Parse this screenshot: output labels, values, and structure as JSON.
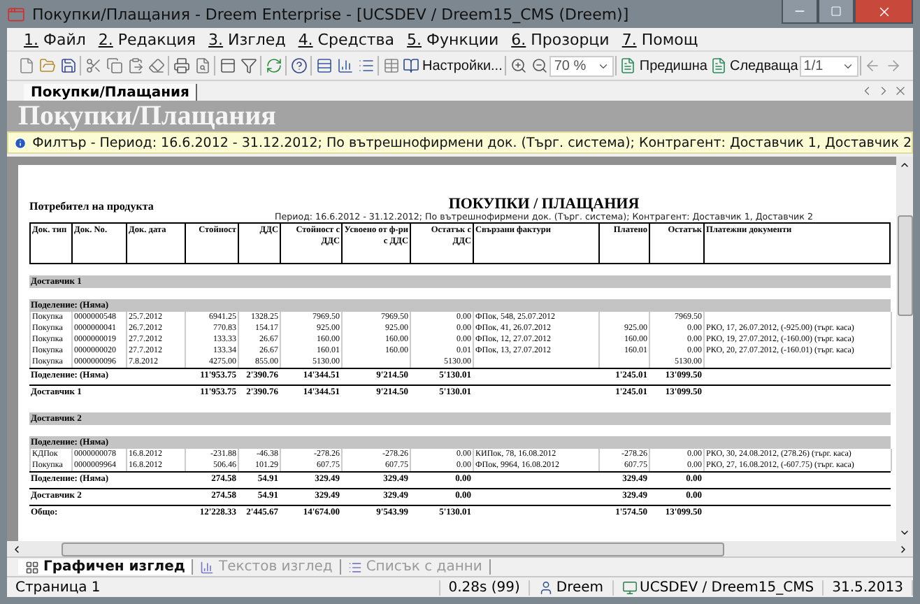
{
  "window": {
    "title": "Покупки/Плащания - Dreem Enterprise - [UCSDEV / Dreem15_CMS (Dreem)]"
  },
  "menu": [
    "1. Файл",
    "2. Редакция",
    "3. Изглед",
    "4. Средства",
    "5. Функции",
    "6. Прозорци",
    "7. Помощ"
  ],
  "toolbar": {
    "settings_label": "Настройки...",
    "zoom": "70 %",
    "previous_label": "Предишна",
    "next_label": "Следваща",
    "page": "1/1"
  },
  "document_tabs": [
    {
      "label": "Покупки/Плащания",
      "selected": true
    }
  ],
  "header": {
    "title": "Покупки/Плащания"
  },
  "filter": "Филтър - Период: 16.6.2012 - 31.12.2012; По вътрешнофирмени док. (Търг. система); Контрагент: Доставчик 1, Доставчик 2",
  "report": {
    "user_label": "Потребител на продукта",
    "title": "ПОКУПКИ / ПЛАЩАНИЯ",
    "subtitle": "Период: 16.6.2012 - 31.12.2012; По вътрешнофирмени док. (Търг. система); Контрагент: Доставчик 1, Доставчик 2",
    "columns": [
      {
        "label": "Док. тип",
        "kind": "text"
      },
      {
        "label": "Док. No.",
        "kind": "text"
      },
      {
        "label": "Док. дата",
        "kind": "text"
      },
      {
        "label": "Стойност",
        "kind": "amount"
      },
      {
        "label": "ДДС",
        "kind": "amount"
      },
      {
        "label": "Стойност с ДДС",
        "kind": "amount"
      },
      {
        "label": "Усвоено от ф-ри с ДДС",
        "kind": "amount"
      },
      {
        "label": "Остатък с ДДС",
        "kind": "amount"
      },
      {
        "label": "Свързани фактури",
        "kind": "text"
      },
      {
        "label": "Платено",
        "kind": "amount"
      },
      {
        "label": "Остатък",
        "kind": "amount"
      },
      {
        "label": "Платежни документи",
        "kind": "text"
      }
    ],
    "rows": [
      {
        "kind": "group",
        "label": "Доставчик 1"
      },
      {
        "kind": "group",
        "label": "Поделение: (Няма)"
      },
      {
        "kind": "data",
        "cells": [
          "Покупка",
          "0000000548",
          "25.7.2012",
          "6941.25",
          "1328.25",
          "7969.50",
          "7969.50",
          "0.00",
          "ФПок, 548, 25.07.2012",
          null,
          "7969.50",
          null
        ]
      },
      {
        "kind": "data",
        "cells": [
          "Покупка",
          "0000000041",
          "26.7.2012",
          "770.83",
          "154.17",
          "925.00",
          "925.00",
          "0.00",
          "ФПок, 41, 26.07.2012",
          "925.00",
          "0.00",
          "РКО, 17, 26.07.2012, (-925.00) (търг. каса)"
        ]
      },
      {
        "kind": "data",
        "cells": [
          "Покупка",
          "0000000019",
          "27.7.2012",
          "133.33",
          "26.67",
          "160.00",
          "160.00",
          "0.00",
          "ФПок, 12, 27.07.2012",
          "160.00",
          "0.00",
          "РКО, 19, 27.07.2012, (-160.00) (търг. каса)"
        ]
      },
      {
        "kind": "data",
        "cells": [
          "Покупка",
          "0000000020",
          "27.7.2012",
          "133.34",
          "26.67",
          "160.01",
          "160.00",
          "0.01",
          "ФПок, 13, 27.07.2012",
          "160.01",
          "0.00",
          "РКО, 20, 27.07.2012, (-160.01) (търг. каса)"
        ]
      },
      {
        "kind": "data",
        "cells": [
          "Покупка",
          "0000000096",
          "7.8.2012",
          "4275.00",
          "855.00",
          "5130.00",
          null,
          "5130.00",
          null,
          null,
          "5130.00",
          null
        ]
      },
      {
        "kind": "total",
        "label": "Поделение: (Няма)",
        "cells": [
          "11'953.75",
          "2'390.76",
          "14'344.51",
          "9'214.50",
          "5'130.01",
          null,
          "1'245.01",
          "13'099.50"
        ]
      },
      {
        "kind": "total",
        "label": "Доставчик 1",
        "cells": [
          "11'953.75",
          "2'390.76",
          "14'344.51",
          "9'214.50",
          "5'130.01",
          null,
          "1'245.01",
          "13'099.50"
        ]
      },
      {
        "kind": "group",
        "label": "Доставчик 2"
      },
      {
        "kind": "group",
        "label": "Поделение: (Няма)"
      },
      {
        "kind": "data",
        "cells": [
          "КДПок",
          "0000000078",
          "16.8.2012",
          "-231.88",
          "-46.38",
          "-278.26",
          "-278.26",
          "0.00",
          "КИПок, 78, 16.08.2012",
          "-278.26",
          "0.00",
          "РКО, 30, 24.08.2012, (278.26) (търг. каса)"
        ]
      },
      {
        "kind": "data",
        "cells": [
          "Покупка",
          "0000009964",
          "16.8.2012",
          "506.46",
          "101.29",
          "607.75",
          "607.75",
          "0.00",
          "ФПок, 9964, 16.08.2012",
          "607.75",
          "0.00",
          "РКО, 27, 16.08.2012, (-607.75) (търг. каса)"
        ]
      },
      {
        "kind": "total",
        "label": "Поделение: (Няма)",
        "cells": [
          "274.58",
          "54.91",
          "329.49",
          "329.49",
          "0.00",
          null,
          "329.49",
          "0.00"
        ]
      },
      {
        "kind": "total",
        "label": "Доставчик 2",
        "cells": [
          "274.58",
          "54.91",
          "329.49",
          "329.49",
          "0.00",
          null,
          "329.49",
          "0.00"
        ]
      },
      {
        "kind": "total",
        "label": "Общо:",
        "cells": [
          "12'228.33",
          "2'445.67",
          "14'674.00",
          "9'543.99",
          "5'130.01",
          null,
          "1'574.50",
          "13'099.50"
        ]
      }
    ]
  },
  "view_tabs": [
    {
      "label": "Графичен изглед",
      "selected": true
    },
    {
      "label": "Текстов изглед",
      "selected": false
    },
    {
      "label": "Списък с данни",
      "selected": false
    }
  ],
  "status_bar": {
    "page": "Страница 1",
    "timing": "0.28s (99)",
    "user": "Dreem",
    "database": "UCSDEV / Dreem15_CMS",
    "date": "31.5.2013"
  }
}
